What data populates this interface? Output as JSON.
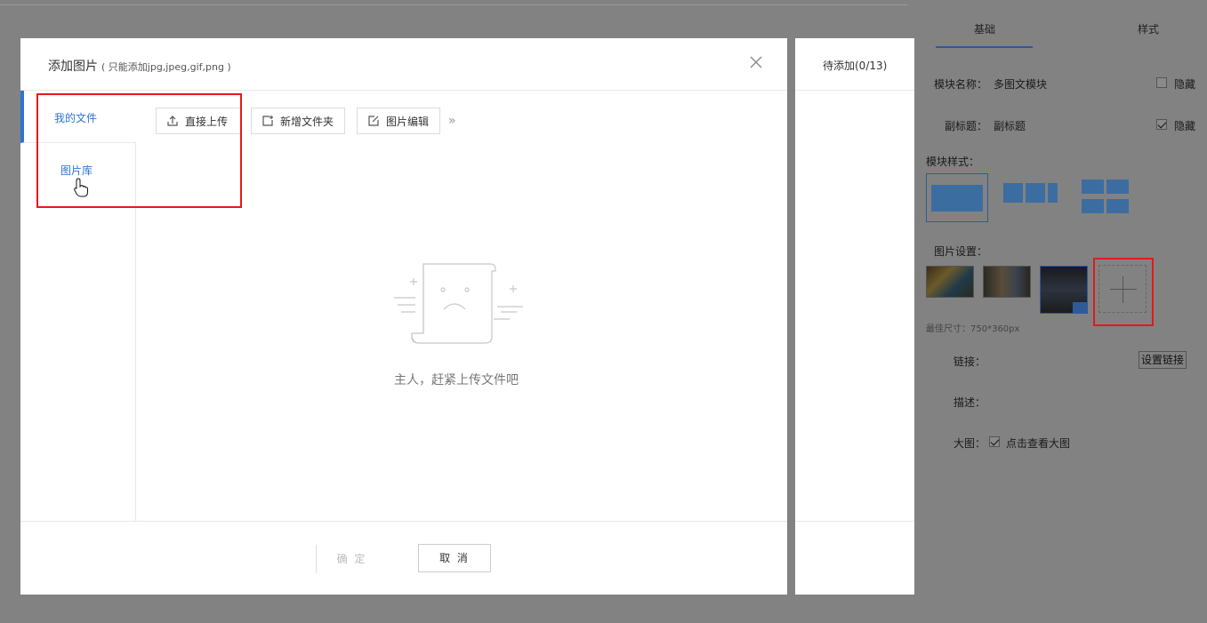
{
  "modal": {
    "title": "添加图片",
    "subtitle": "( 只能添加jpg,jpeg,gif,png )",
    "sidebar": [
      "我的文件",
      "图片库"
    ],
    "toolbar": {
      "upload": "直接上传",
      "new_folder": "新增文件夹",
      "edit": "图片编辑"
    },
    "empty_text": "主人，赶紧上传文件吧",
    "confirm": "确 定",
    "cancel": "取 消"
  },
  "pending": {
    "title": "待添加(0/13)"
  },
  "panel": {
    "tabs": [
      "基础",
      "样式"
    ],
    "module_name_label": "模块名称：",
    "module_name_value": "多图文模块",
    "hide_label": "隐藏",
    "subtitle_label": "副标题：",
    "subtitle_value": "副标题",
    "hide_label_2": "隐藏",
    "style_label": "模块样式：",
    "image_setting_label": "图片设置：",
    "best_size": "最佳尺寸：750*360px",
    "link_label": "链接：",
    "link_button": "设置链接",
    "desc_label": "描述：",
    "bigimg_label": "大图：",
    "bigimg_option": "点击查看大图"
  },
  "colors": {
    "accent": "#2f74d0",
    "highlight": "#e01b1b",
    "overlay": "#828282"
  }
}
